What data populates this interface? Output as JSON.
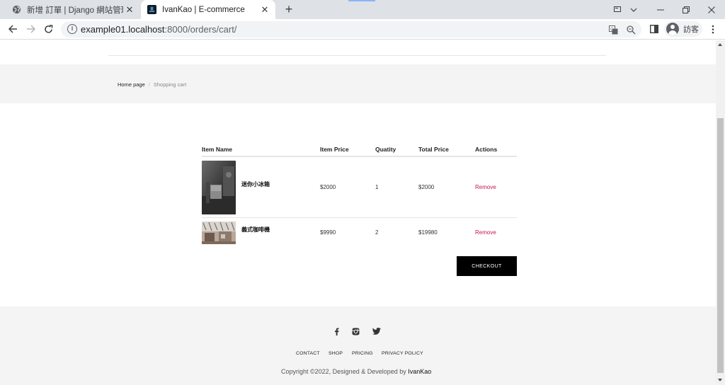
{
  "browser": {
    "tabs": [
      {
        "title": "新增 訂單 | Django 網站管理",
        "active": false,
        "icon": "globe-icon"
      },
      {
        "title": "IvanKao | E-commerce",
        "active": true,
        "icon": "site-favicon"
      }
    ],
    "url_host": "example01.localhost",
    "url_rest": ":8000/orders/cart/",
    "profile_label": "訪客",
    "colors": {
      "tab_strip": "#dee1e6",
      "omnibox": "#f1f3f4"
    }
  },
  "breadcrumb": {
    "home": "Home page",
    "separator": "/",
    "current": "Shopping cart"
  },
  "cart": {
    "headers": {
      "name": "Item Name",
      "price": "Item Price",
      "qty": "Quatity",
      "total": "Total Price",
      "actions": "Actions"
    },
    "items": [
      {
        "name": "迷你小冰箱",
        "price": "$2000",
        "qty": "1",
        "total": "$2000",
        "action": "Remove"
      },
      {
        "name": "義式咖啡機",
        "price": "$9990",
        "qty": "2",
        "total": "$19980",
        "action": "Remove"
      }
    ],
    "checkout_label": "CHECKOUT",
    "colors": {
      "remove": "#c2185b",
      "checkout_bg": "#000000"
    }
  },
  "footer": {
    "social": [
      "facebook-icon",
      "instagram-icon",
      "twitter-icon"
    ],
    "nav": [
      "CONTACT",
      "SHOP",
      "PRICING",
      "PRIVACY POLICY"
    ],
    "copyright": "Copyright ©2022, Designed & Developed by ",
    "brand": "IvanKao"
  }
}
